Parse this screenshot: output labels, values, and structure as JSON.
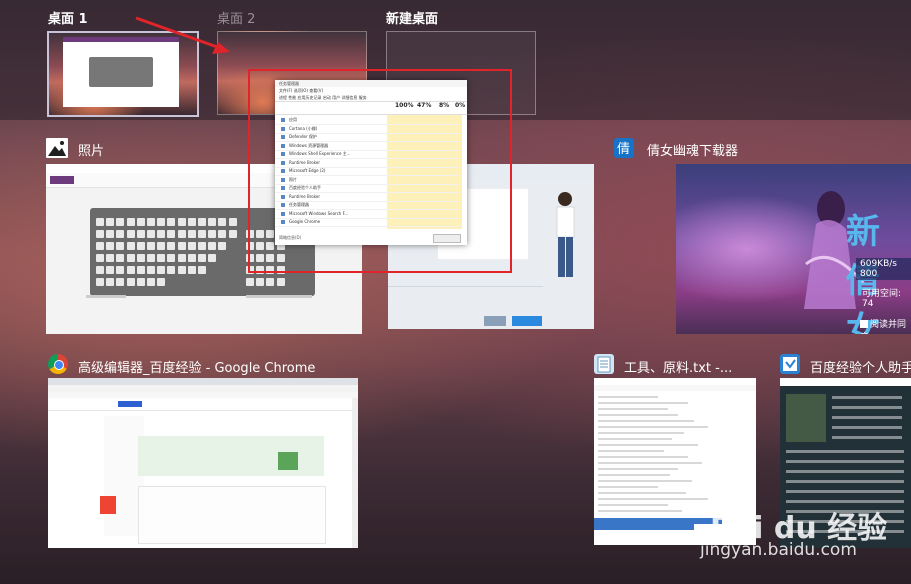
{
  "desktops": [
    {
      "label": "桌面 1",
      "active": true
    },
    {
      "label": "桌面 2",
      "active": false
    },
    {
      "label": "新建桌面",
      "active": false
    }
  ],
  "windows": [
    {
      "title": "照片",
      "icon": "photos-icon"
    },
    {
      "title": "倩女幽魂下载器",
      "icon": "qnyh-downloader-icon"
    },
    {
      "title": "高级编辑器_百度经验 - Google Chrome",
      "icon": "chrome-icon"
    },
    {
      "title": "工具、原料.txt -...",
      "icon": "notepad-icon"
    },
    {
      "title": "百度经验个人助手",
      "icon": "baidu-helper-icon"
    }
  ],
  "game": {
    "title": "新倩女",
    "speed": "609KB/s 800",
    "space": "可用空间: 74",
    "agree": "阅读并同意"
  },
  "taskmgr": {
    "stats": [
      "100%",
      "47%",
      "8%",
      "0%"
    ],
    "processes": [
      "应用",
      "Cortana (小娜)",
      "Defender 保护",
      "Windows 资源管理器",
      "Windows Shell Experience 主...",
      "Runtime Broker",
      "Microsoft Edge (2)",
      "照片",
      "百度经验个人助手",
      "Runtime Broker",
      "任务管理器",
      "Microsoft Windows Search F...",
      "Google Chrome"
    ],
    "footer": "简略信息(D)"
  },
  "watermark": {
    "logo": "Bai du 经验",
    "url": "jingyan.baidu.com"
  },
  "colors": {
    "highlight_red": "#e0242a",
    "active_border": "#c9c3d8"
  }
}
